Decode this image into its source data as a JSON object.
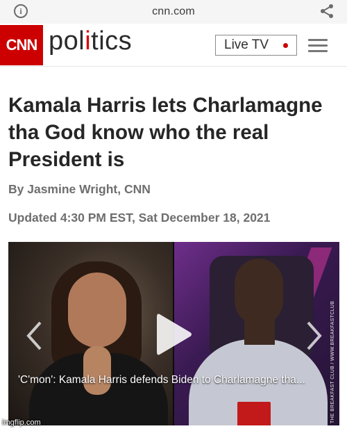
{
  "browser": {
    "url": "cnn.com",
    "info_icon": "info-icon",
    "share_icon": "share-icon"
  },
  "header": {
    "logo_text": "CNN",
    "section_pre": "pol",
    "section_accent": "i",
    "section_post": "tics",
    "live_tv_label": "Live TV",
    "menu_icon": "hamburger-menu-icon",
    "colors": {
      "brand": "#cc0000",
      "live_dot": "#cc0000"
    }
  },
  "article": {
    "headline": "Kamala Harris lets Charlamagne tha God know who the real President is",
    "byline": "By Jasmine Wright, CNN",
    "updated": "Updated 4:30 PM EST, Sat December 18, 2021"
  },
  "video": {
    "caption": "'C'mon': Kamala Harris defends Biden to Charlamagne tha...",
    "side_text": "THE BREAKFAST CLUB / WWW.BREAKFASTCLUB",
    "play_icon": "play-icon",
    "prev_icon": "chevron-left-icon",
    "next_icon": "chevron-right-icon"
  },
  "watermark": "imgflip.com"
}
